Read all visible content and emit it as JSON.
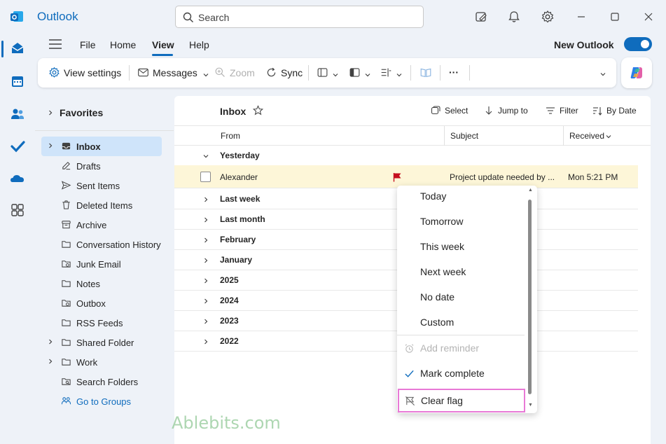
{
  "app": {
    "name": "Outlook"
  },
  "search": {
    "placeholder": "Search"
  },
  "ribbon": {
    "tabs": [
      {
        "label": "File"
      },
      {
        "label": "Home"
      },
      {
        "label": "View"
      },
      {
        "label": "Help"
      }
    ],
    "active_tab": "View",
    "new_outlook_label": "New Outlook",
    "new_outlook_enabled": true
  },
  "toolbar": {
    "view_settings": "View settings",
    "messages": "Messages",
    "zoom": "Zoom",
    "sync": "Sync",
    "more": "···"
  },
  "folders": {
    "favorites_label": "Favorites",
    "items": [
      {
        "label": "Inbox",
        "icon": "inbox-icon"
      },
      {
        "label": "Drafts",
        "icon": "drafts-icon"
      },
      {
        "label": "Sent Items",
        "icon": "send-icon"
      },
      {
        "label": "Deleted Items",
        "icon": "trash-icon"
      },
      {
        "label": "Archive",
        "icon": "archive-icon"
      },
      {
        "label": "Conversation History",
        "icon": "folder-icon"
      },
      {
        "label": "Junk Email",
        "icon": "junk-icon"
      },
      {
        "label": "Notes",
        "icon": "folder-icon"
      },
      {
        "label": "Outbox",
        "icon": "outbox-icon"
      },
      {
        "label": "RSS Feeds",
        "icon": "folder-icon"
      },
      {
        "label": "Shared Folder",
        "icon": "folder-icon"
      },
      {
        "label": "Work",
        "icon": "folder-icon"
      },
      {
        "label": "Search Folders",
        "icon": "search-folder-icon"
      },
      {
        "label": "Go to Groups",
        "icon": "groups-icon"
      }
    ]
  },
  "maillist": {
    "title": "Inbox",
    "commands": {
      "select": "Select",
      "jump_to": "Jump to",
      "filter": "Filter",
      "sort": "By Date"
    },
    "columns": {
      "from": "From",
      "subject": "Subject",
      "received": "Received"
    },
    "groups": [
      {
        "label": "Yesterday"
      },
      {
        "label": "Last week"
      },
      {
        "label": "Last month"
      },
      {
        "label": "February"
      },
      {
        "label": "January"
      },
      {
        "label": "2025"
      },
      {
        "label": "2024"
      },
      {
        "label": "2023"
      },
      {
        "label": "2022"
      }
    ],
    "message": {
      "sender": "Alexander",
      "subject": "Project update needed by ...",
      "received": "Mon 5:21 PM",
      "flag_color": "#c50f1f"
    }
  },
  "flag_menu": {
    "items": [
      {
        "label": "Today"
      },
      {
        "label": "Tomorrow"
      },
      {
        "label": "This week"
      },
      {
        "label": "Next week"
      },
      {
        "label": "No date"
      },
      {
        "label": "Custom"
      },
      {
        "label": "Add reminder"
      },
      {
        "label": "Mark complete"
      },
      {
        "label": "Clear flag"
      }
    ]
  },
  "watermark": "Ablebits.com",
  "colors": {
    "accent": "#0f6cbd",
    "highlight_row": "#fdf6d8",
    "selected_folder": "#cfe4fa",
    "menu_highlight_border": "#e879d6"
  }
}
